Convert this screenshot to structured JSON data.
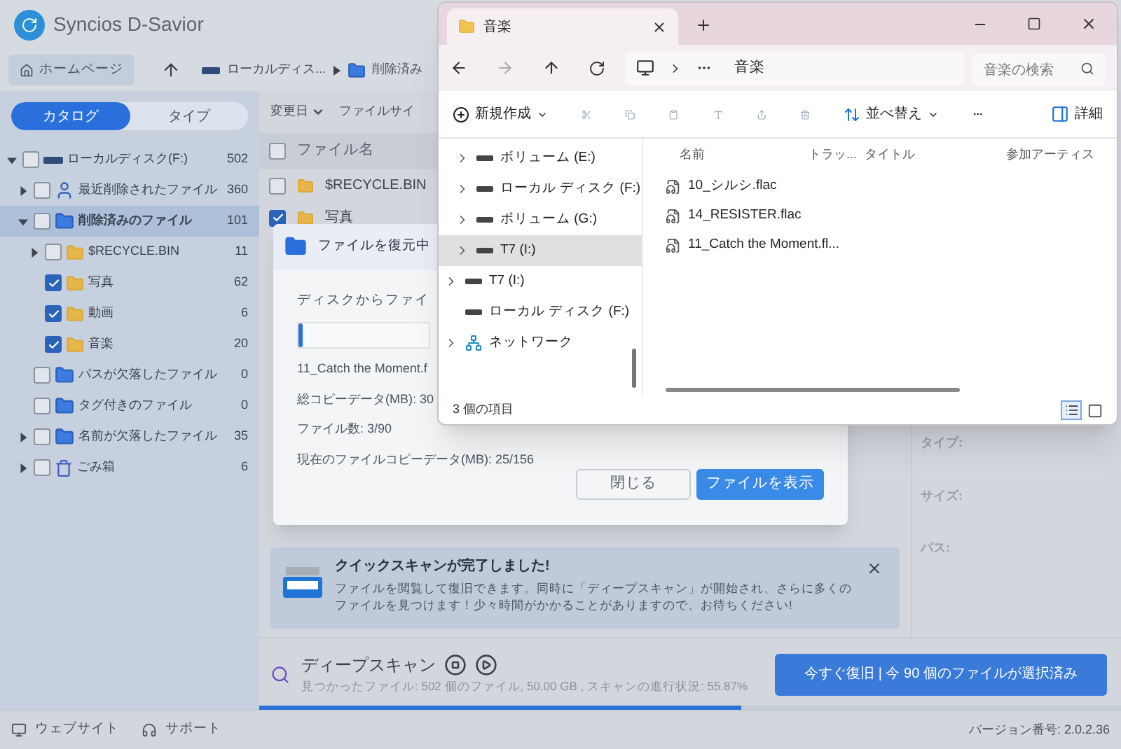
{
  "app": {
    "title": "Syncios D-Savior",
    "home_button": "ホームページ",
    "breadcrumb": [
      "ローカルディス...",
      "削除済み"
    ]
  },
  "sidebar": {
    "tabs": [
      {
        "label": "カタログ",
        "selected": true
      },
      {
        "label": "タイプ",
        "selected": false
      }
    ],
    "tree": [
      {
        "kind": "drive",
        "label": "ローカルディスク(F:)",
        "count": "502",
        "arrow": true,
        "expanded": true,
        "checked": false,
        "selected": false,
        "children": [
          {
            "kind": "recent",
            "label": "最近削除されたファイル",
            "count": "360",
            "arrow": true,
            "expanded": false,
            "checked": false,
            "selected": false
          },
          {
            "kind": "category",
            "label": "削除済みのファイル",
            "count": "101",
            "arrow": true,
            "expanded": true,
            "checked": false,
            "selected": true,
            "children": [
              {
                "kind": "folder",
                "label": "$RECYCLE.BIN",
                "count": "11",
                "arrow": true,
                "expanded": false,
                "checked": false,
                "selected": false
              },
              {
                "kind": "folder",
                "label": "写真",
                "count": "62",
                "arrow": false,
                "expanded": false,
                "checked": true,
                "selected": false
              },
              {
                "kind": "folder",
                "label": "動画",
                "count": "6",
                "arrow": false,
                "expanded": false,
                "checked": true,
                "selected": false
              },
              {
                "kind": "folder",
                "label": "音楽",
                "count": "20",
                "arrow": false,
                "expanded": false,
                "checked": true,
                "selected": false
              }
            ]
          },
          {
            "kind": "category",
            "label": "パスが欠落したファイル",
            "count": "0",
            "arrow": false,
            "expanded": false,
            "checked": false,
            "selected": false
          },
          {
            "kind": "category",
            "label": "タグ付きのファイル",
            "count": "0",
            "arrow": false,
            "expanded": false,
            "checked": false,
            "selected": false
          },
          {
            "kind": "category",
            "label": "名前が欠落したファイル",
            "count": "35",
            "arrow": true,
            "expanded": false,
            "checked": false,
            "selected": false
          },
          {
            "kind": "trash",
            "label": "ごみ箱",
            "count": "6",
            "arrow": true,
            "expanded": false,
            "checked": false,
            "selected": false
          }
        ]
      }
    ]
  },
  "file_list": {
    "sort_options": [
      "変更日",
      "ファイルサイ"
    ],
    "header": {
      "label": "ファイル名",
      "checked": false
    },
    "rows": [
      {
        "name": "$RECYCLE.BIN",
        "checked": false
      },
      {
        "name": "写真",
        "checked": true
      }
    ]
  },
  "details": {
    "labels": [
      "タイプ:",
      "サイズ:",
      "パス:"
    ]
  },
  "dialog": {
    "title": "ファイルを復元中",
    "subtitle": "ディスクからファイ",
    "level": 0.03,
    "current_file": "11_Catch the Moment.f",
    "stats": [
      "総コピーデータ(MB): 30",
      "ファイル数: 3/90",
      "現在のファイルコピーデータ(MB): 25/156"
    ],
    "close_button": "閉じる",
    "show_button": "ファイルを表示"
  },
  "notice": {
    "title": "クイックスキャンが完了しました!",
    "body": "ファイルを閲覧して復旧できます。同時に「ディープスキャン」が開始され、さらに多くのファイルを見つけます！少々時間がかかることがありますので、お待ちください!"
  },
  "deep_scan": {
    "title": "ディープスキャン",
    "status": "見つかったファイル: 502 個のファイル, 50.00 GB , スキャンの進行状況: 55.87%",
    "level": 0.5587,
    "recover_button": "今すぐ復旧 | 今 90 個のファイルが選択済み"
  },
  "status_bar": {
    "links": [
      "ウェブサイト",
      "サポート"
    ],
    "version": "バージョン番号: 2.0.2.36"
  },
  "explorer": {
    "tab": "音楽",
    "address": "音楽",
    "search": {
      "placeholder": "音楽の検索"
    },
    "new_button": "新規作成",
    "sort_button": "並べ替え",
    "details_button": "詳細",
    "nav_pane": {
      "nested_items": [
        {
          "label": "ボリューム (E:)",
          "kind": "drive",
          "expandable": true,
          "selected": false
        },
        {
          "label": "ローカル ディスク (F:)",
          "kind": "drive",
          "expandable": true,
          "selected": false
        },
        {
          "label": "ボリューム (G:)",
          "kind": "drive",
          "expandable": true,
          "selected": false
        },
        {
          "label": "T7 (I:)",
          "kind": "drive",
          "expandable": true,
          "selected": true
        }
      ],
      "items": [
        {
          "label": "T7 (I:)",
          "kind": "drive",
          "expandable": true,
          "selected": false
        },
        {
          "label": "ローカル ディスク (F:)",
          "kind": "drive",
          "expandable": false,
          "selected": false
        },
        {
          "label": "ネットワーク",
          "kind": "network",
          "expandable": true,
          "selected": false
        }
      ]
    },
    "columns": [
      "名前",
      "トラッ...",
      "タイトル",
      "参加アーティス"
    ],
    "files": [
      "10_シルシ.flac",
      "14_RESISTER.flac",
      "11_Catch the Moment.fl..."
    ],
    "status": "3 個の項目"
  }
}
